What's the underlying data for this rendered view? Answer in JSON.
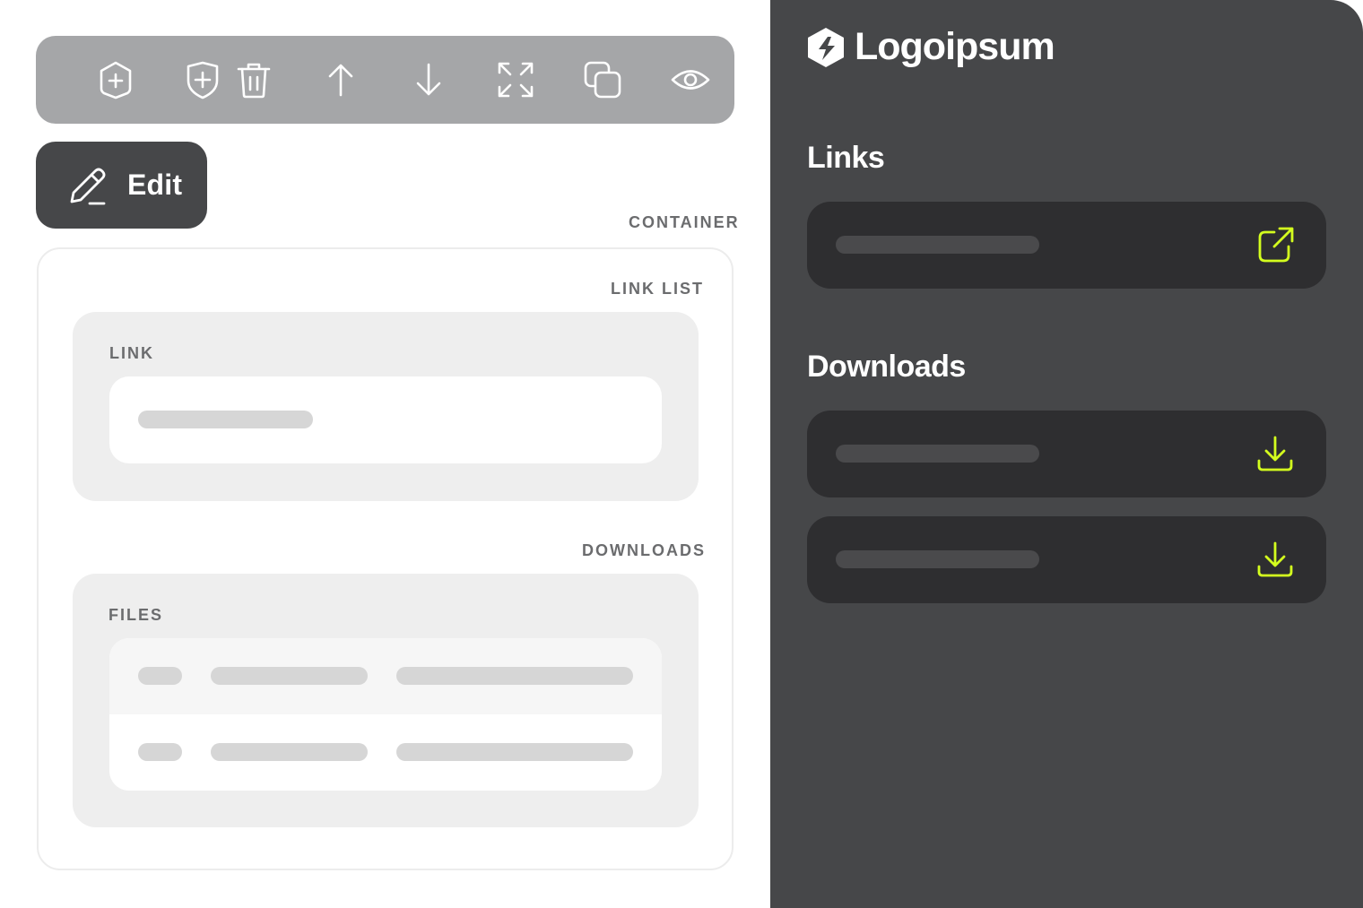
{
  "editor": {
    "toolbar": {
      "tools": [
        {
          "name": "add-block",
          "icon": "hexagon-plus-icon"
        },
        {
          "name": "add-section",
          "icon": "shield-plus-icon"
        },
        {
          "name": "delete",
          "icon": "trash-icon"
        },
        {
          "name": "move-up",
          "icon": "arrow-up-icon"
        },
        {
          "name": "move-down",
          "icon": "arrow-down-icon"
        },
        {
          "name": "expand",
          "icon": "expand-icon"
        },
        {
          "name": "duplicate",
          "icon": "copy-icon"
        },
        {
          "name": "preview",
          "icon": "eye-icon"
        }
      ]
    },
    "edit_button": {
      "label": "Edit",
      "icon": "pencil-icon"
    },
    "container_label": "CONTAINER",
    "link_list_label": "LINK LIST",
    "link_label": "LINK",
    "downloads_label": "DOWNLOADS",
    "files_label": "FILES"
  },
  "preview": {
    "logo_text": "Logoipsum",
    "links_title": "Links",
    "downloads_title": "Downloads",
    "link_action_icon": "external-link-icon",
    "download_action_icon": "download-icon"
  },
  "colors": {
    "toolbar_bg": "#a5a6a8",
    "edit_bg": "#464749",
    "preview_bg": "#464749",
    "card_bg": "#2e2e30",
    "accent": "#d4ff1e"
  }
}
